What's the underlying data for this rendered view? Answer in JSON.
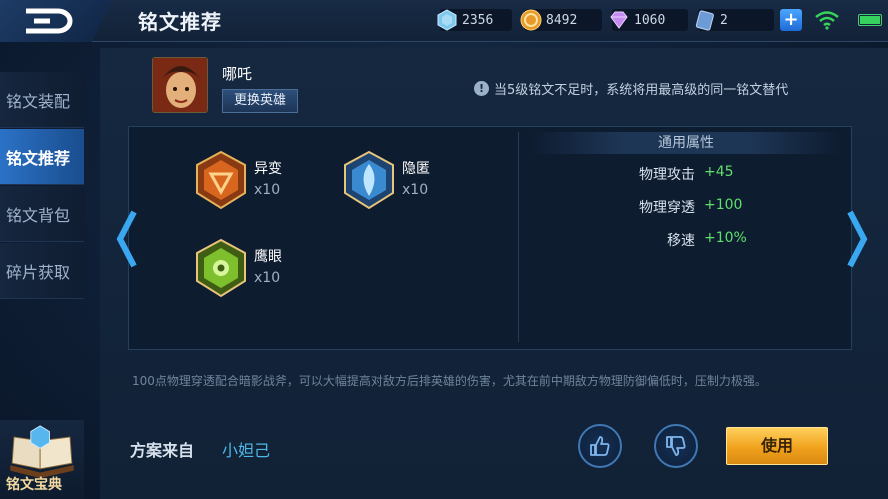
{
  "header": {
    "title": "铭文推荐",
    "resources": [
      {
        "icon": "diamond-icon",
        "value": "2356"
      },
      {
        "icon": "gold-coin-icon",
        "value": "8492"
      },
      {
        "icon": "gem-icon",
        "value": "1060"
      },
      {
        "icon": "ticket-icon",
        "value": "2"
      }
    ]
  },
  "sidebar": {
    "items": [
      {
        "label": "铭文装配"
      },
      {
        "label": "铭文推荐"
      },
      {
        "label": "铭文背包"
      },
      {
        "label": "碎片获取"
      }
    ],
    "book_label": "铭文宝典"
  },
  "hero": {
    "name": "哪吒",
    "change_label": "更换英雄"
  },
  "notice": "当5级铭文不足时，系统将用最高级的同一铭文替代",
  "runes": [
    {
      "name": "异变",
      "count": "x10",
      "color": "#d9661f"
    },
    {
      "name": "隐匿",
      "count": "x10",
      "color": "#3a8ad0"
    },
    {
      "name": "鹰眼",
      "count": "x10",
      "color": "#7dbf2c"
    }
  ],
  "attributes": {
    "title": "通用属性",
    "rows": [
      {
        "key": "物理攻击",
        "value": "+45"
      },
      {
        "key": "物理穿透",
        "value": "+100"
      },
      {
        "key": "移速",
        "value": "+10%"
      }
    ]
  },
  "description": "100点物理穿透配合暗影战斧，可以大幅提高对敌方后排英雄的伤害，尤其在前中期敌方物理防御偏低时，压制力极强。",
  "source": {
    "label": "方案来自",
    "author": "小妲己"
  },
  "actions": {
    "use_label": "使用"
  },
  "colors": {
    "accent": "#2b72c6",
    "positive": "#5fe06b",
    "author": "#4fb8e8",
    "use_button": "#f0a21c"
  }
}
